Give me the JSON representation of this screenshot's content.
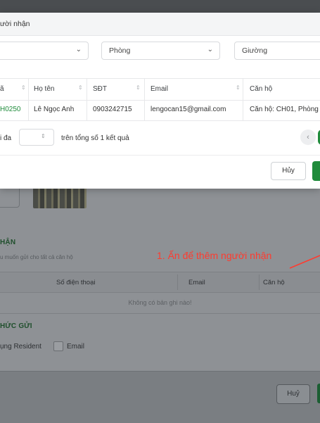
{
  "modal": {
    "title": "ười nhận",
    "filters": {
      "first_value": "",
      "room_placeholder": "Phòng",
      "bed_placeholder": "Giường"
    },
    "table": {
      "headers": [
        "ã",
        "Họ tên",
        "SĐT",
        "Email",
        "Căn hộ"
      ],
      "rows": [
        {
          "code": "H0250",
          "name": "Lê Ngọc Anh",
          "phone": "0903242715",
          "email": "lengocan15@gmail.com",
          "apartment": "Căn hộ: CH01, Phòng"
        }
      ]
    },
    "pagination": {
      "prefix": "i đa",
      "summary": "trên tổng số 1 kết quả"
    },
    "cancel_label": "Hủy"
  },
  "background": {
    "section_recipients_title": "HẬN",
    "section_recipients_sub": "u muốn gửi cho tất cả căn hộ",
    "headers": [
      "Số điện thoại",
      "Email",
      "Căn hộ"
    ],
    "empty_text": "Không có bản ghi nào!",
    "section_method_title": "HỨC GỬI",
    "method_app_label": "ụng Resident",
    "method_email_label": "Email",
    "cancel_label": "Huỷ"
  },
  "annotation": {
    "text": "1. Ấn để thêm người nhận",
    "color": "#ff3b2f"
  },
  "colors": {
    "primary_green": "#1f8b3b",
    "overlay": "#8b8f93"
  }
}
